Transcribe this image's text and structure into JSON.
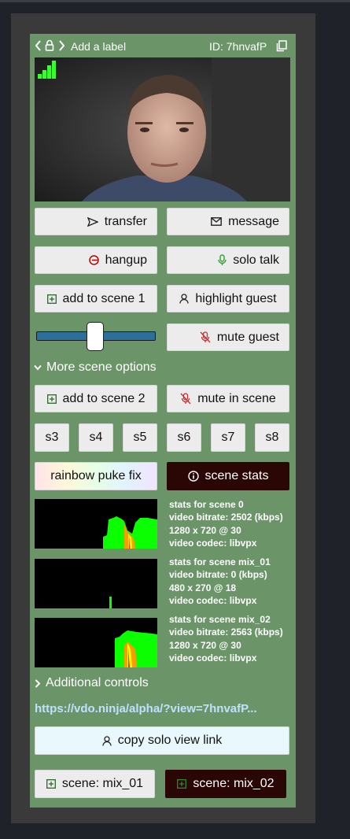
{
  "header": {
    "label": "Add a label",
    "id_text": "ID: 7hnvafP"
  },
  "buttons": {
    "transfer": "transfer",
    "message": "message",
    "hangup": "hangup",
    "solo_talk": "solo talk",
    "add_scene1": "add to scene 1",
    "highlight": "highlight guest",
    "mute_guest": "mute guest",
    "add_scene2": "add to scene 2",
    "mute_scene": "mute in scene",
    "rainbow": "rainbow puke fix",
    "scene_stats": "scene stats",
    "copy_solo": "copy solo view link",
    "scene_mix01": "scene: mix_01",
    "scene_mix02": "scene: mix_02"
  },
  "scene_buttons": [
    "s3",
    "s4",
    "s5",
    "s6",
    "s7",
    "s8"
  ],
  "toggles": {
    "more_scene": "More scene options",
    "additional": "Additional controls"
  },
  "volume": {
    "level": 0.49
  },
  "stats": [
    {
      "title": "stats for scene 0",
      "bitrate": "video bitrate: 2502 (kbps)",
      "res": "1280 x 720 @ 30",
      "codec": "video codec: libvpx"
    },
    {
      "title": "stats for scene mix_01",
      "bitrate": "video bitrate: 0 (kbps)",
      "res": "480 x 270 @ 18",
      "codec": "video codec: libvpx"
    },
    {
      "title": "stats for scene mix_02",
      "bitrate": "video bitrate: 2563 (kbps)",
      "res": "1280 x 720 @ 30",
      "codec": "video codec: libvpx"
    }
  ],
  "link": "https://vdo.ninja/alpha/?view=7hnvafP...",
  "icons": {
    "back": "chevron-left-icon",
    "lock": "lock-icon",
    "fwd": "chevron-right-icon",
    "copy": "copy-icon",
    "signal": "signal-icon",
    "transfer": "send-icon",
    "message": "envelope-icon",
    "hangup": "hangup-icon",
    "mic": "mic-icon",
    "add": "plus-square-icon",
    "person": "person-icon",
    "mic_off": "mic-off-icon",
    "info": "info-icon"
  },
  "colors": {
    "card": "#6b9569",
    "frame": "#3a3a3a",
    "dark_button": "#2a0605",
    "signal": "#36ff2b",
    "link": "#bfe0ff"
  }
}
